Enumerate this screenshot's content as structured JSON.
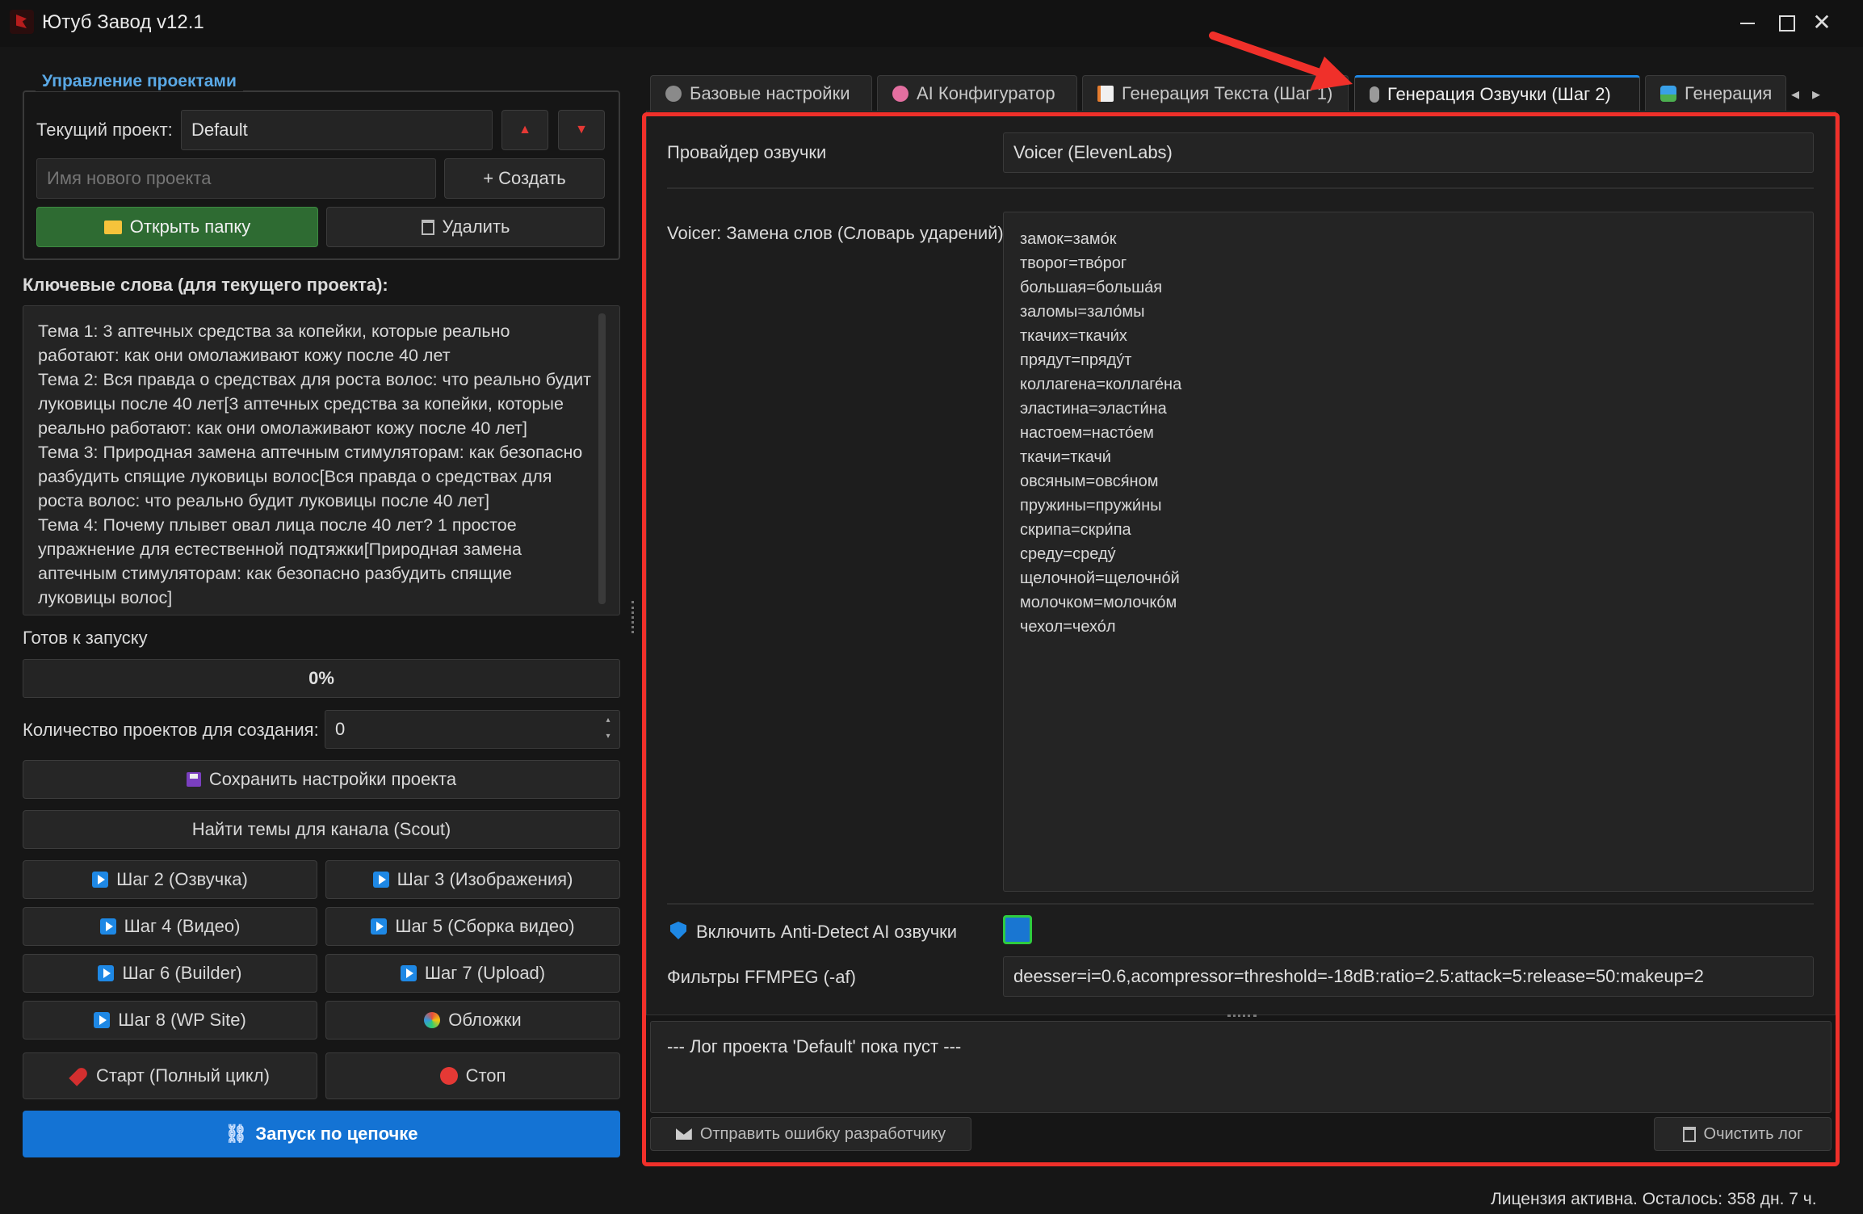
{
  "window": {
    "title": "Ютуб Завод v12.1",
    "min": "—",
    "max": "☐",
    "close": "✕"
  },
  "projects": {
    "group_title": "Управление проектами",
    "current_label": "Текущий проект:",
    "current_value": "Default",
    "up": "▲",
    "down": "▼",
    "new_placeholder": "Имя нового проекта",
    "create_label": "+ Создать",
    "open_folder_label": "Открыть папку",
    "delete_label": "Удалить"
  },
  "keywords": {
    "label": "Ключевые слова (для текущего проекта):",
    "text": "Тема 1: 3 аптечных средства за копейки, которые реально\nработают: как они омолаживают кожу после 40 лет\nТема 2: Вся правда о средствах для роста волос: что реально будит\nлуковицы после 40 лет[3 аптечных средства за копейки, которые\nреально работают: как они омолаживают кожу после 40 лет]\nТема 3: Природная замена аптечным стимуляторам: как безопасно\nразбудить спящие луковицы волос[Вся правда о средствах для\nроста волос: что реально будит луковицы после 40 лет]\nТема 4: Почему плывет овал лица после 40 лет? 1 простое\nупражнение для естественной подтяжки[Природная замена\nаптечным стимуляторам: как безопасно разбудить спящие\nлуковицы волос]"
  },
  "status": {
    "ready": "Готов к запуску",
    "progress_text": "0%",
    "progress_fraction": 0
  },
  "count": {
    "label": "Количество проектов для создания:",
    "value": "0"
  },
  "actions": {
    "save_settings": "Сохранить настройки проекта",
    "find_topics": "Найти темы для канала (Scout)",
    "step2": "Шаг 2 (Озвучка)",
    "step3": "Шаг 3 (Изображения)",
    "step4": "Шаг 4 (Видео)",
    "step5": "Шаг 5 (Сборка видео)",
    "step6": "Шаг 6 (Builder)",
    "step7": "Шаг 7 (Upload)",
    "step8": "Шаг 8 (WP Site)",
    "covers": "Обложки",
    "start_full": "Старт (Полный цикл)",
    "stop": "Стоп",
    "chain_run": "Запуск по цепочке",
    "chain_icon": "⛓"
  },
  "tabs": [
    {
      "label": "Базовые настройки",
      "icon": "gear-icon",
      "active": false
    },
    {
      "label": "AI Конфигуратор",
      "icon": "brain-icon",
      "active": false
    },
    {
      "label": "Генерация Текста (Шаг 1)",
      "icon": "document-icon",
      "active": false
    },
    {
      "label": "Генерация Озвучки (Шаг 2)",
      "icon": "microphone-icon",
      "active": true
    },
    {
      "label": "Генерация",
      "icon": "image-icon",
      "active": false
    }
  ],
  "tab_scroll": {
    "left": "◂",
    "right": "▸"
  },
  "voice": {
    "provider_label": "Провайдер озвучки",
    "provider_value": "Voicer (ElevenLabs)",
    "dict_label": "Voicer: Замена слов (Словарь ударений)",
    "dict_text": "замок=замо́к\nтворог=тво́рог\nбольшая=больша́я\nзаломы=зало́мы\nткачих=ткачи́х\nпрядут=пряду́т\nколлагена=коллаге́на\nэластина=эласти́на\nнастоем=насто́ем\nткачи=ткачи́\nовсяным=овся́ном\nпружины=пружи́ны\nскрипа=скри́па\nсреду=среду́\nщелочной=щелочно́й\nмолочком=молочко́м\nчехол=чехо́л",
    "antidetect_label": "Включить Anti-Detect AI озвучки",
    "antidetect_checked": true,
    "ffmpeg_label": "Фильтры FFMPEG (-af)",
    "ffmpeg_value": "deesser=i=0.6,acompressor=threshold=-18dB:ratio=2.5:attack=5:release=50:makeup=2"
  },
  "log": {
    "text": "--- Лог проекта 'Default' пока пуст ---",
    "send_error": "Отправить ошибку разработчику",
    "clear": "Очистить лог"
  },
  "footer": {
    "license": "Лицензия активна. Осталось: 358 дн. 7 ч."
  }
}
